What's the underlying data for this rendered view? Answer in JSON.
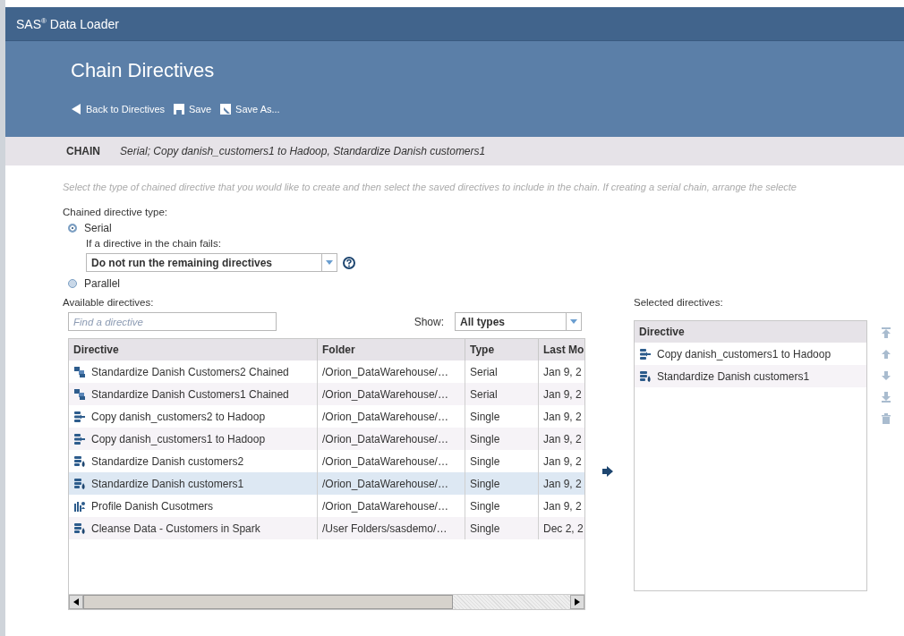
{
  "app": {
    "brand": "SAS",
    "brand_mark": "®",
    "product": "Data Loader"
  },
  "page": {
    "title": "Chain Directives"
  },
  "toolbar": [
    {
      "kind": "back",
      "label": "Back to Directives"
    },
    {
      "kind": "save",
      "label": "Save"
    },
    {
      "kind": "saveas",
      "label": "Save As..."
    }
  ],
  "chain": {
    "label": "CHAIN",
    "value": "Serial; Copy danish_customers1 to Hadoop, Standardize Danish customers1"
  },
  "instructions": "Select the type of chained directive that you would like to create and then select the saved directives to include in the chain. If creating a serial chain, arrange the selecte",
  "type_label": "Chained directive type:",
  "types": [
    {
      "label": "Serial",
      "selected": true
    },
    {
      "label": "Parallel",
      "selected": false
    }
  ],
  "fail_label": "If a directive in the chain fails:",
  "fail_select": {
    "value": "Do not run the remaining directives"
  },
  "available_label": "Available directives:",
  "search": {
    "placeholder": "Find a directive"
  },
  "show_label": "Show:",
  "show_select": {
    "value": "All types"
  },
  "available_table": {
    "columns": [
      "Directive",
      "Folder",
      "Type",
      "Last Mo"
    ],
    "rows": [
      {
        "kind": "chained",
        "cells": [
          "Standardize Danish Customers2 Chained",
          "/Orion_DataWarehouse/…",
          "Serial",
          "Jan 9, 2"
        ],
        "selected": false
      },
      {
        "kind": "chained",
        "cells": [
          "Standardize Danish Customers1 Chained",
          "/Orion_DataWarehouse/…",
          "Serial",
          "Jan 9, 2"
        ],
        "selected": false
      },
      {
        "kind": "copy",
        "cells": [
          "Copy danish_customers2 to Hadoop",
          "/Orion_DataWarehouse/…",
          "Single",
          "Jan 9, 2"
        ],
        "selected": false
      },
      {
        "kind": "copy",
        "cells": [
          "Copy danish_customers1 to Hadoop",
          "/Orion_DataWarehouse/…",
          "Single",
          "Jan 9, 2"
        ],
        "selected": false
      },
      {
        "kind": "standardize",
        "cells": [
          "Standardize Danish customers2",
          "/Orion_DataWarehouse/…",
          "Single",
          "Jan 9, 2"
        ],
        "selected": false
      },
      {
        "kind": "standardize",
        "cells": [
          "Standardize Danish customers1",
          "/Orion_DataWarehouse/…",
          "Single",
          "Jan 9, 2"
        ],
        "selected": true
      },
      {
        "kind": "profile",
        "cells": [
          "Profile Danish Cusotmers",
          "/Orion_DataWarehouse/…",
          "Single",
          "Jan 9, 2"
        ],
        "selected": false
      },
      {
        "kind": "standardize",
        "cells": [
          "Cleanse Data - Customers in Spark",
          "/User Folders/sasdemo/…",
          "Single",
          "Dec 2, 2"
        ],
        "selected": false
      }
    ]
  },
  "selected_label": "Selected directives:",
  "selected_table": {
    "columns": [
      "Directive"
    ],
    "rows": [
      {
        "kind": "copy",
        "cells": [
          "Copy danish_customers1 to Hadoop"
        ]
      },
      {
        "kind": "standardize",
        "cells": [
          "Standardize Danish customers1"
        ]
      }
    ]
  },
  "order_buttons": [
    {
      "kind": "top",
      "disabled": true
    },
    {
      "kind": "up",
      "disabled": true
    },
    {
      "kind": "down",
      "disabled": true
    },
    {
      "kind": "bottom",
      "disabled": true
    },
    {
      "kind": "delete",
      "disabled": true
    }
  ]
}
